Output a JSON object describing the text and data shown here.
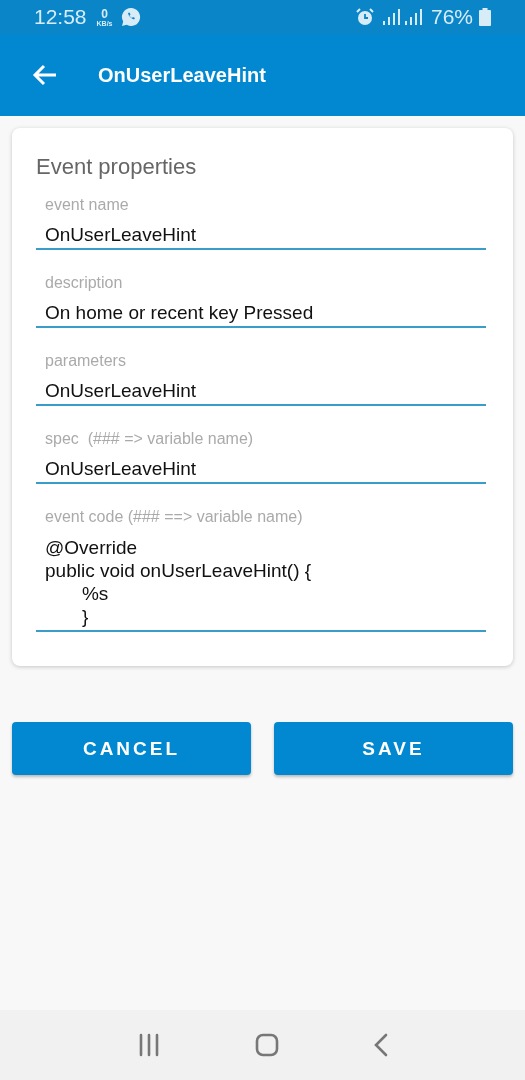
{
  "status_bar": {
    "time": "12:58",
    "net_speed": "0",
    "net_unit": "KB/s",
    "battery": "76%"
  },
  "app_bar": {
    "title": "OnUserLeaveHint"
  },
  "card": {
    "title": "Event properties",
    "fields": [
      {
        "label": "event name",
        "value": "OnUserLeaveHint",
        "kind": "line"
      },
      {
        "label": "description",
        "value": "On home or recent key Pressed",
        "kind": "line"
      },
      {
        "label": "parameters",
        "value": "OnUserLeaveHint",
        "kind": "line"
      },
      {
        "label": "spec  (### => variable name)",
        "value": "OnUserLeaveHint",
        "kind": "line"
      },
      {
        "label": "event code (### ==> variable name)",
        "value": "@Override\npublic void onUserLeaveHint() {\n       %s\n       }",
        "kind": "multiline"
      }
    ]
  },
  "buttons": [
    "CANCEL",
    "SAVE"
  ]
}
